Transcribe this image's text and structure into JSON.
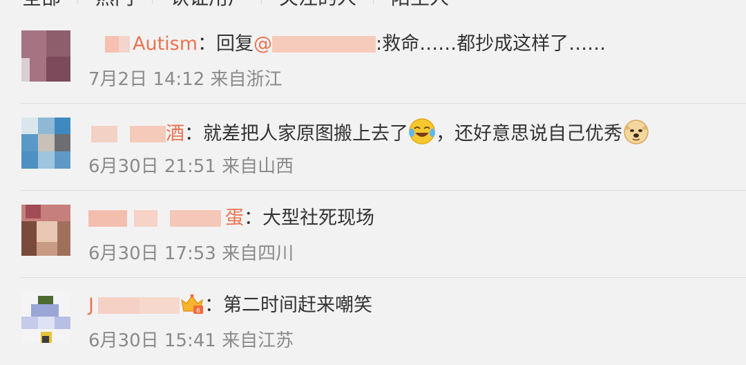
{
  "tabs": [
    {
      "label": "全部"
    },
    {
      "label": "热门"
    },
    {
      "label": "认证用户"
    },
    {
      "label": "关注的人"
    },
    {
      "label": "陌生人"
    }
  ],
  "comments": [
    {
      "username": "Autism",
      "text_prefix": "回复",
      "mention": "@",
      "text": ":救命……都抄成这样了……",
      "time": "7月2日 14:12",
      "location": "来自浙江",
      "emoji": "",
      "emoji2": ""
    },
    {
      "username": "酒",
      "text": "就差把人家原图搬上去了",
      "emoji": "laugh-cry-emoji",
      "text2": "，还好意思说自己优秀",
      "emoji2": "doge-emoji",
      "time": "6月30日 21:51",
      "location": "来自山西"
    },
    {
      "username": "蛋",
      "text": "大型社死现场",
      "time": "6月30日 17:53",
      "location": "来自四川"
    },
    {
      "username": "J",
      "text": "第二时间赶来嘲笑",
      "badge": "vip-crown-icon",
      "time": "6月30日 15:41",
      "location": "来自江苏"
    }
  ],
  "colors": {
    "username": "#eb7350",
    "meta": "#8a8a8a",
    "text": "#333333",
    "background": "#f2f2f2"
  }
}
